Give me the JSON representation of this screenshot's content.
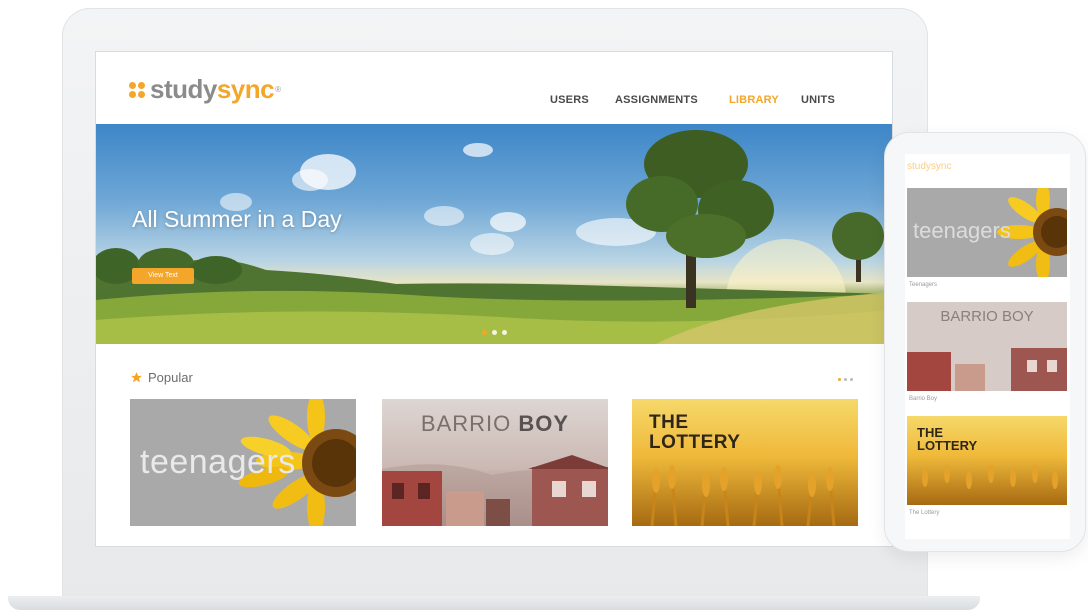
{
  "brand": {
    "name_part1": "study",
    "name_part2": "sync",
    "registered": "®"
  },
  "nav": {
    "items": [
      "USERS",
      "ASSIGNMENTS",
      "LIBRARY",
      "UNITS"
    ],
    "active": "LIBRARY"
  },
  "hero": {
    "title": "All Summer in a Day",
    "button_label": "View Text",
    "slides_total": 3,
    "slide_active": 1
  },
  "popular": {
    "label": "Popular",
    "cards": [
      {
        "title": "teenagers"
      },
      {
        "title_part1": "BARRIO ",
        "title_part2": "BOY"
      },
      {
        "line1": "THE",
        "line2": "LOTTERY"
      }
    ]
  },
  "phone": {
    "logo": "studysync",
    "cards": [
      {
        "title": "teenagers",
        "caption": "Teenagers"
      },
      {
        "title": "BARRIO BOY",
        "caption": "Barrio Boy"
      },
      {
        "line1": "THE",
        "line2": "LOTTERY",
        "caption": "The Lottery"
      }
    ]
  },
  "colors": {
    "accent": "#f4a62a",
    "nav_text": "#4a4a4a",
    "logo_gray": "#8b8b8b"
  }
}
